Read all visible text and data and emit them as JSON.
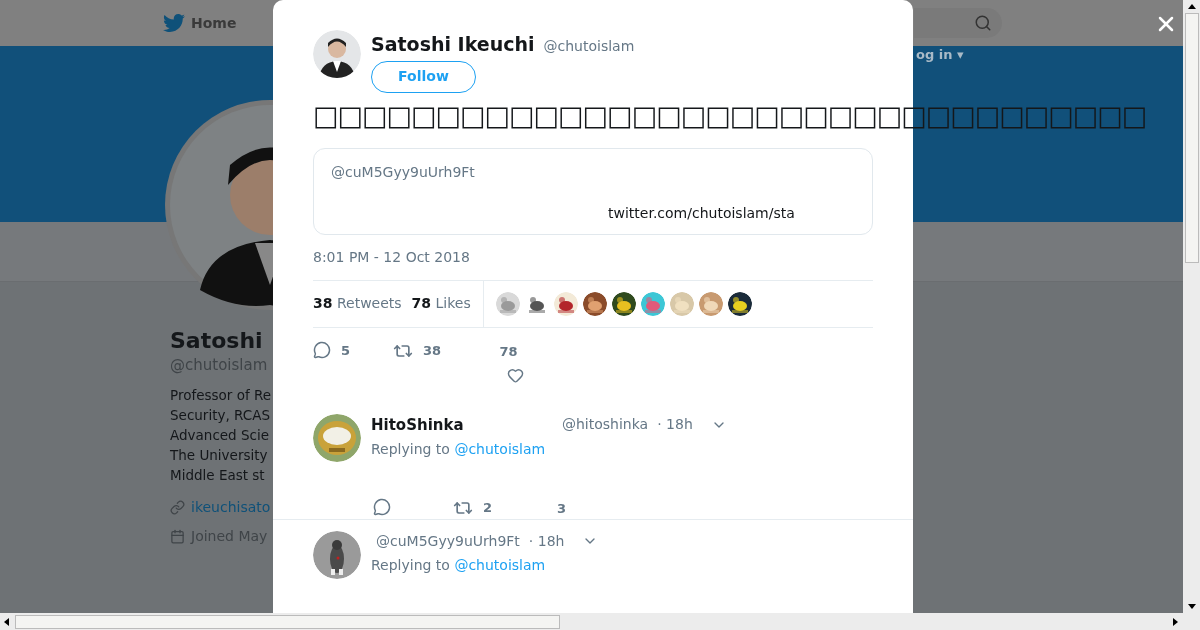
{
  "background_page": {
    "nav": {
      "home": "Home"
    },
    "login": "og in ▾",
    "profile": {
      "name": "Satoshi",
      "handle": "@chutoislam",
      "bio": [
        "Professor of Re",
        "Security, RCAS",
        "Advanced Scie",
        "The University",
        "Middle East st"
      ],
      "link": "ikeuchisato",
      "joined": "Joined May"
    }
  },
  "tweet_modal": {
    "author": {
      "name": "Satoshi Ikeuchi",
      "handle": "@chutoislam",
      "follow_button": "Follow"
    },
    "text": "□□□□□□□□□□□□□□□□□□□□□□□□□□□□□□□□□□",
    "quoted_card": {
      "handle": "@cuM5Gyy9uUrh9Ft",
      "link": "twitter.com/chutoislam/sta"
    },
    "timestamp": "8:01 PM - 12 Oct 2018",
    "stats": {
      "retweets_count": "38",
      "retweets_label": "Retweets",
      "likes_count": "78",
      "likes_label": "Likes"
    },
    "actions": {
      "replies": "5",
      "retweets": "38",
      "likes": "78"
    },
    "replies": [
      {
        "name": "HitoShinka",
        "handle": "@hitoshinka",
        "time": "· 18h",
        "replying_label": "Replying to",
        "replying_to": "@chutoislam",
        "actions": {
          "retweets": "2",
          "likes": "3"
        }
      },
      {
        "handle": "@cuM5Gyy9uUrh9Ft",
        "time": "· 18h",
        "replying_label": "Replying to",
        "replying_to": "@chutoislam"
      }
    ]
  }
}
